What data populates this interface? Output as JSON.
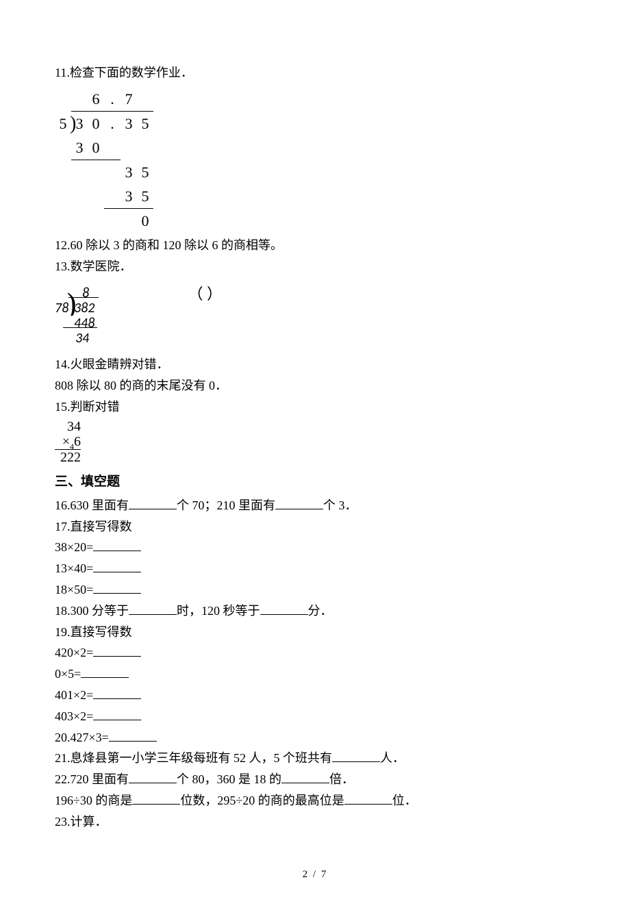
{
  "q11": {
    "text": "11.检查下面的数学作业．",
    "div": {
      "divisor": "5",
      "quotient": [
        "6",
        ".",
        "7"
      ],
      "dividend": [
        "3",
        "0",
        ".",
        "3",
        "5"
      ],
      "step1": [
        "3",
        "0"
      ],
      "step2": [
        "3",
        "5"
      ],
      "step3": [
        "3",
        "5"
      ],
      "remainder": "0"
    }
  },
  "q12": "12.60 除以 3 的商和 120 除以 6 的商相等。",
  "q13": {
    "text": "13.数学医院．",
    "paren": "（   ）",
    "q": "8",
    "divisor": "78",
    "dividend": "382",
    "sub": "448",
    "diff": "34"
  },
  "q14a": "14.火眼金睛辨对错．",
  "q14b": "808 除以 80 的商的末尾没有 0．",
  "q15": "15.判断对错",
  "q15mul": {
    "a": "34",
    "b_sign": "×",
    "b_carry": "4",
    "b_digit": "6",
    "res": "222"
  },
  "section3": "三、填空题",
  "q16a": "16.630 里面有",
  "q16b": "个 70；210 里面有",
  "q16c": "个 3．",
  "q17": "17.直接写得数",
  "q17a": "38×20=",
  "q17b": "13×40=",
  "q17c": "18×50=",
  "q18a": "18.300 分等于",
  "q18b": "时，120 秒等于",
  "q18c": "分．",
  "q19": "19.直接写得数",
  "q19a": "420×2=",
  "q19b": "0×5=",
  "q19c": "401×2=",
  "q19d": "403×2=",
  "q20": "20.427×3=",
  "q21a": "21.息烽县第一小学三年级每班有 52 人，5 个班共有",
  "q21b": "人．",
  "q22a": "22.720 里面有",
  "q22b": "个 80，360 是 18 的",
  "q22c": "倍．",
  "q22d": "196÷30 的商是",
  "q22e": "位数，295÷20 的商的最高位是",
  "q22f": "位．",
  "q23": "23.计算．",
  "footer": "2 / 7"
}
